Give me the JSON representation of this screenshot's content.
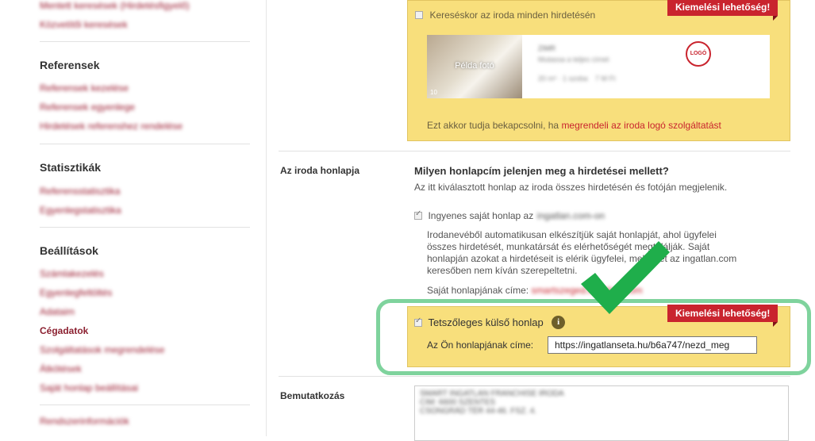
{
  "sidebar": {
    "top_links": [
      "Mentett keresések (Hirdetésfigyelő)",
      "Közvetítői keresések"
    ],
    "sections": [
      {
        "title": "Referensek",
        "links": [
          "Referensek kezelése",
          "Referensek egyenlege",
          "Hirdetések referenshez rendelése"
        ]
      },
      {
        "title": "Statisztikák",
        "links": [
          "Referensstatisztika",
          "Egyenlegstatisztika"
        ]
      },
      {
        "title": "Beállítások",
        "links": [
          "Számlakezelés",
          "Egyenlegfeltöltés",
          "Adataim",
          "Cégadatok",
          "Szolgáltatások megrendelése",
          "Átkötések",
          "Saját honlap beállításai"
        ]
      }
    ],
    "bottom_link": "Rendszerinformációk"
  },
  "logo_section": {
    "checkbox_label": "Kereséskor az iroda minden hirdetésén",
    "ribbon": "Kiemelési lehetőség!",
    "example": {
      "photo_label": "Példa fotó",
      "photo_count": "10",
      "logo_text": "LOGÓ",
      "line1": "ZIMR",
      "line2": "Mutassa a teljes címet",
      "line3a": "20 m² · 1 szoba",
      "line3b": "7 M Ft"
    },
    "footer_prefix": "Ezt akkor tudja bekapcsolni, ha ",
    "footer_link": "megrendeli az iroda logó szolgáltatást"
  },
  "homepage_section": {
    "label": "Az iroda honlapja",
    "question": "Milyen honlapcím jelenjen meg a hirdetései mellett?",
    "subtitle": "Az itt kiválasztott honlap az iroda összes hirdetésén és fotóján megjelenik.",
    "option1_label": "Ingyenes saját honlap az",
    "option1_domain": "ingatlan.com-on",
    "option1_desc": [
      "Irodanevéből automatikusan elkészítjük saját honlapját, ahol ügyfelei",
      "összes hirdetését, munkatársát és elérhetőségét megtalálják. Saját",
      "honlapján azokat a hirdetéseit is elérik ügyfelei, melyeket az ingatlan.com",
      "keresőben nem kíván szerepeltetni."
    ],
    "own_page_label": "Saját honlapjának címe:",
    "own_page_value": "smartszeged.ingatlan.com",
    "option2_label": "Tetszőleges külső honlap",
    "option2_ribbon": "Kiemelési lehetőség!",
    "url_label": "Az Ön honlapjának címe:",
    "url_value": "https://ingatlanseta.hu/b6a747/nezd_meg"
  },
  "intro_section": {
    "label": "Bemutatkozás",
    "lines": [
      "SMART INGATLAN FRANCHISE IRODA",
      "CIM: 6600 SZENTES",
      "CSONGRÁD TÉR 44-46. FSZ. 4."
    ]
  },
  "colors": {
    "accent": "#c9242e",
    "highlight": "#7fd39d",
    "yellow": "#f8df7c"
  }
}
